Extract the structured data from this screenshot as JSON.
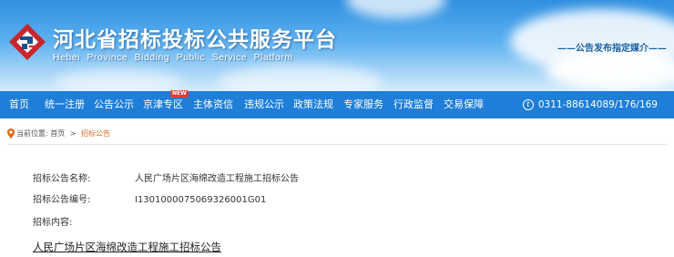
{
  "header": {
    "title": "河北省招标投标公共服务平台",
    "subtitle": "Hebei Province Bidding Public Service Platform",
    "slogan": "——公告发布指定媒介——"
  },
  "nav": {
    "items": [
      {
        "label": "首页"
      },
      {
        "label": "统一注册"
      },
      {
        "label": "公告公示"
      },
      {
        "label": "京津专区",
        "badge": "NEW"
      },
      {
        "label": "主体资信"
      },
      {
        "label": "违规公示"
      },
      {
        "label": "政策法规"
      },
      {
        "label": "专家服务"
      },
      {
        "label": "行政监督"
      },
      {
        "label": "交易保障"
      }
    ],
    "phone": "0311-88614089/176/169",
    "phone_icon": "phone-icon"
  },
  "breadcrumb": {
    "prefix": "当前位置:",
    "home": "首页",
    "separator": ">",
    "current": "招标公告"
  },
  "notice": {
    "name_label": "招标公告名称:",
    "name_value": "人民广场片区海绵改造工程施工招标公告",
    "code_label": "招标公告编号:",
    "code_value": "I1301000075069326001G01",
    "content_label": "招标内容:",
    "content_title": "人民广场片区海绵改造工程施工招标公告"
  },
  "colors": {
    "nav_bg": "#1e7ed8",
    "breadcrumb_current": "#d86a1b",
    "logo_red": "#c8262c",
    "logo_blue": "#1b4f8f"
  }
}
